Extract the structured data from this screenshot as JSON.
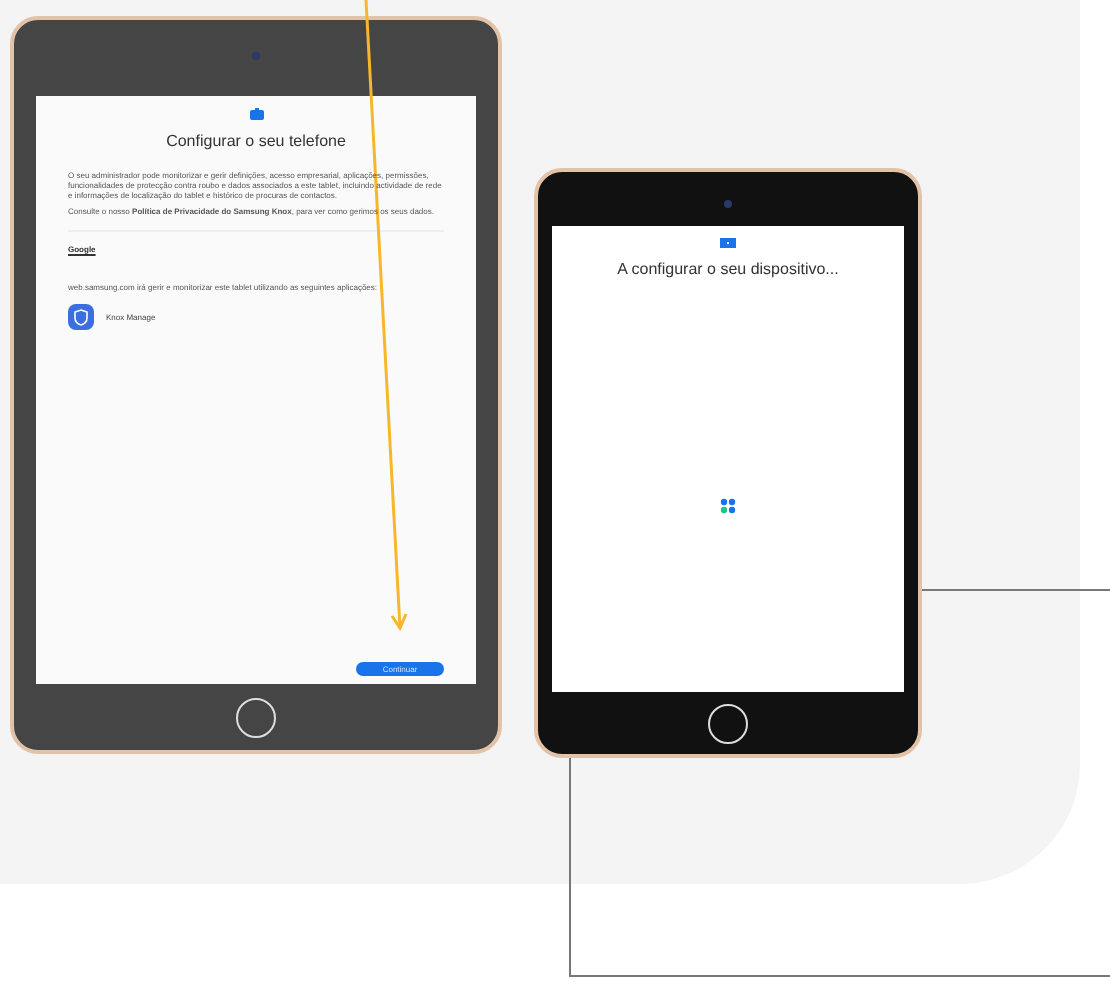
{
  "setup_screen": {
    "title": "Configurar o seu telefone",
    "paragraphs": [
      "O seu administrador pode monitorizar e gerir definições, acesso empresarial, aplicações, permissões, funcionalidades de protecção contra roubo e dados associados a este tablet, incluindo actividade de rede e informações de localização do tablet e histórico de procuras de contactos.",
      "Consulte o nosso **Política de Privacidade do Samsung Knox**, para ver como gerimos os seus dados."
    ],
    "section_title": "Google",
    "apps_note": "web.samsung.com irá gerir e monitorizar este tablet utilizando as seguintes aplicações:",
    "app_name": "Knox Manage",
    "button": "Continuar"
  },
  "progress_screen": {
    "title": "A configurar o seu dispositivo..."
  }
}
